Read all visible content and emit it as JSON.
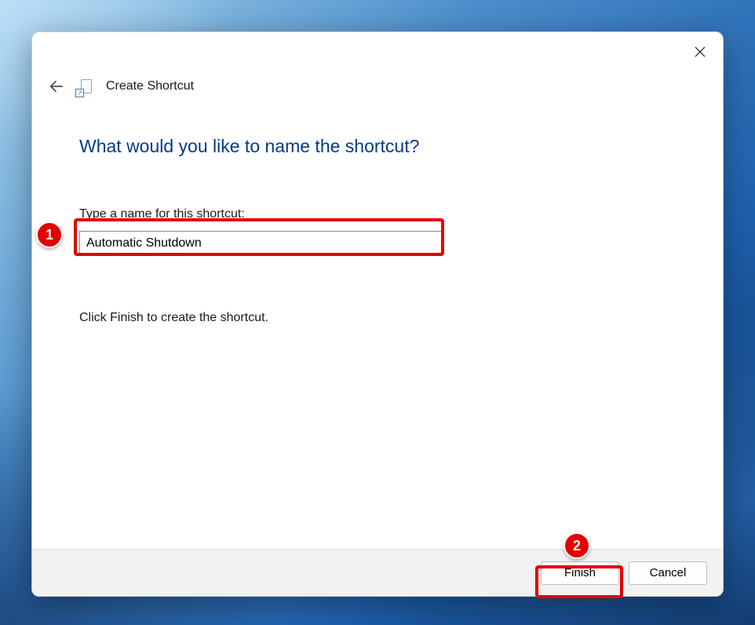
{
  "wizard": {
    "title": "Create Shortcut",
    "heading": "What would you like to name the shortcut?",
    "field_label": "Type a name for this shortcut:",
    "name_value": "Automatic Shutdown",
    "help_text": "Click Finish to create the shortcut."
  },
  "buttons": {
    "finish": "Finish",
    "cancel": "Cancel"
  },
  "annotations": {
    "badge1": "1",
    "badge2": "2"
  }
}
